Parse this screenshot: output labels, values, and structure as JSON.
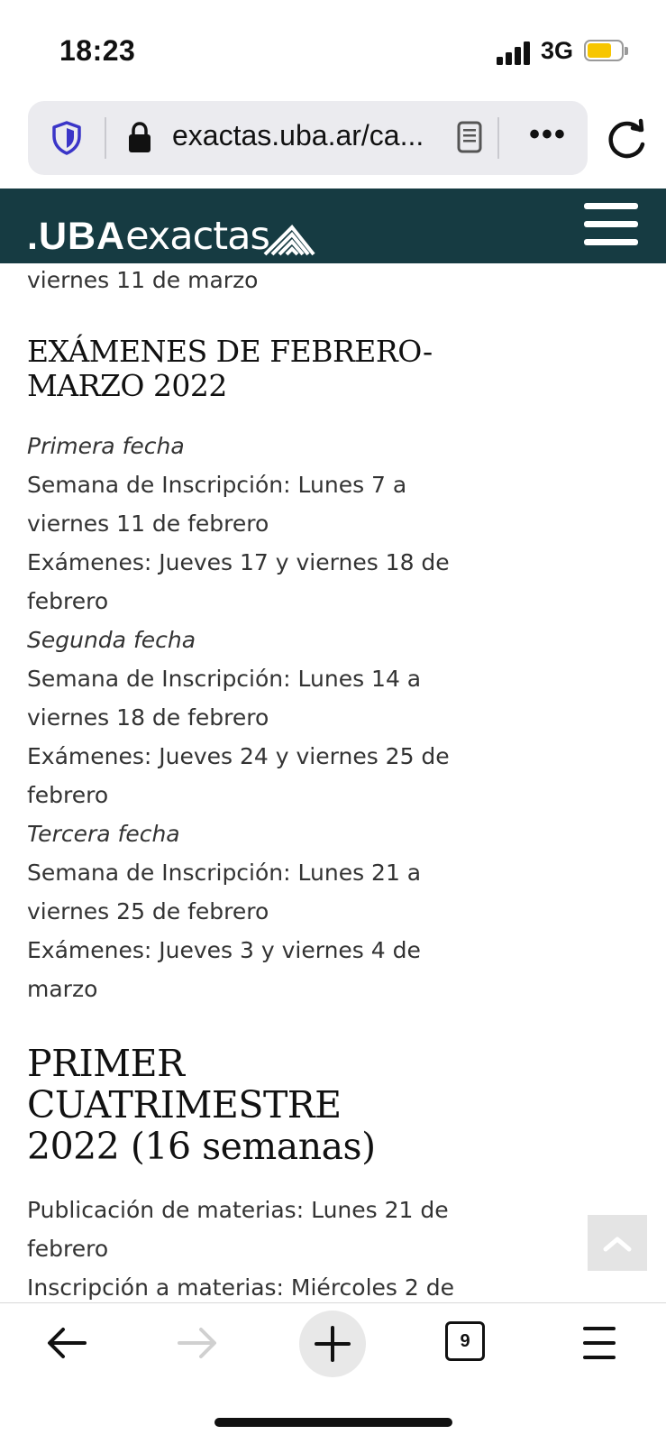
{
  "status_bar": {
    "time": "18:23",
    "network": "3G",
    "battery_level": 0.72,
    "battery_color": "#f7c600"
  },
  "browser": {
    "url": "exactas.uba.ar/ca...",
    "tab_count": "9"
  },
  "site": {
    "logo_uba": ".UBA",
    "logo_exactas": "exactas",
    "header_color": "#163b42"
  },
  "content": {
    "top_line": "viernes 11 de marzo",
    "section1": {
      "title_line1": "EXÁMENES DE FEBRERO-",
      "title_line2": "MARZO 2022",
      "primera": {
        "label": "Primera fecha",
        "l1": "Semana de Inscripción: Lunes 7 a",
        "l2": "viernes 11 de febrero",
        "l3": "Exámenes: Jueves 17 y viernes 18 de",
        "l4": "febrero"
      },
      "segunda": {
        "label": "Segunda fecha",
        "l1": "Semana de Inscripción: Lunes 14 a",
        "l2": "viernes 18 de febrero",
        "l3": "Exámenes: Jueves 24 y viernes 25 de",
        "l4": "febrero"
      },
      "tercera": {
        "label": "Tercera fecha",
        "l1": "Semana de Inscripción: Lunes 21 a",
        "l2": "viernes 25 de febrero",
        "l3": "Exámenes: Jueves 3 y viernes 4 de",
        "l4": "marzo"
      }
    },
    "section2": {
      "title_line1": "PRIMER CUATRIMESTRE",
      "title_line2": "2022 (16 semanas)",
      "l1": "Publicación de materias: Lunes 21 de",
      "l2": "febrero",
      "l3": "Inscripción a materias: Miércoles 2 de"
    }
  }
}
